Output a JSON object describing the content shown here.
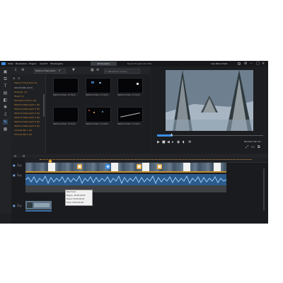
{
  "menubar": {
    "menus": [
      "Datei",
      "Bearbeiten",
      "Plugins",
      "Ansicht",
      "Wiedergabe"
    ],
    "produce_label": "Produzieren",
    "project_title": "Neues Projekt (Ver Pot)",
    "user": "Lisa Marie Metz"
  },
  "library": {
    "content_dropdown": "Weihnachtsprojekt...",
    "search_placeholder": "Bibliothek suchen",
    "folders": [
      "Eigene Fotovideos (2)",
      "Alle Inhalte (113)",
      "Hintergr. (1)",
      "Musik (1)",
      "Halloween Promo (8)",
      "Weihnachtsprojekt 1 (6)",
      "Weihnachtsprojekt 2 (6)",
      "Weihnachtsprojekt 3 (6)",
      "Weihnachtsprojekt 4 (6)",
      "Weihnachtsprojekt 5 (6)",
      "Weihnachtsprojekt 6 (6)",
      "Urlaubs-Teil 1 (6)",
      "Urlaubs-Teil 2 (6)"
    ],
    "thumbnails": [
      "Weihnachten 11 Part...",
      "Weihnachten 11 Part...",
      "Weihnachten 11 Part...",
      "Weihnachten 11 Part...",
      "Weihnachten 11 Part...",
      "Weihnachten 11 Part..."
    ]
  },
  "preview": {
    "render_label": "Rendern der Vo...",
    "colors": {
      "accent": "#3b8fe6",
      "video_sky": "#6e7f90"
    }
  },
  "timeline": {
    "tracks": [
      "1",
      "1",
      "1"
    ],
    "tooltip": {
      "title": "Falls Frost",
      "line1": "Beginn: 00:00:00;00",
      "line2": "Dauer: 00:00:00;00",
      "line3": "Ende: 00:00:00;00"
    },
    "colors": {
      "video_strip": "#2c4560",
      "audio_strip": "#3f72a9",
      "marker": "#e8a93a"
    }
  }
}
